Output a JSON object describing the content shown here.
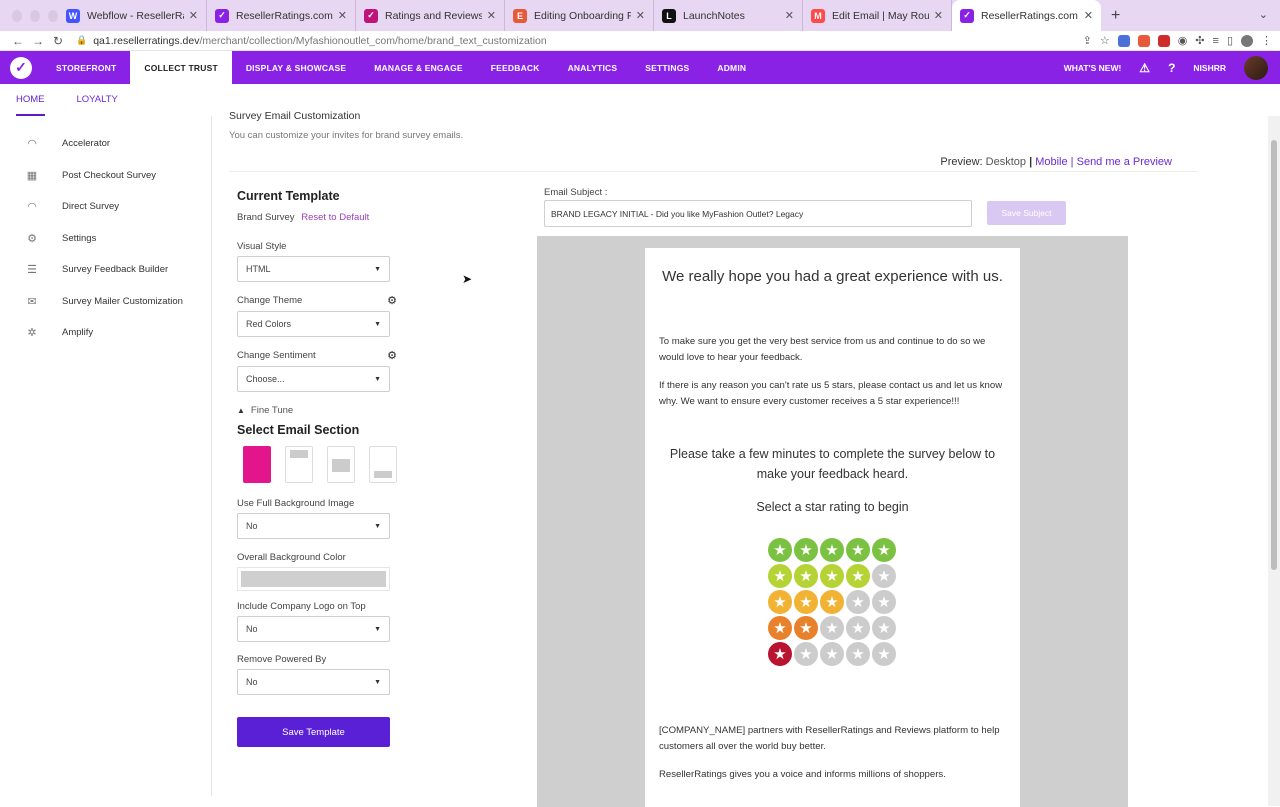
{
  "browser": {
    "tabs": [
      {
        "label": "Webflow - ResellerRatings Lea",
        "favicon": "W",
        "color": "#4353ff",
        "active": false
      },
      {
        "label": "ResellerRatings.com",
        "favicon": "✓",
        "color": "#8a22e6",
        "active": false
      },
      {
        "label": "Ratings and Reviews Learning",
        "favicon": "✓",
        "color": "#c0137a",
        "active": false
      },
      {
        "label": "Editing Onboarding Part II - Da",
        "favicon": "E",
        "color": "#e8593a",
        "active": false
      },
      {
        "label": "LaunchNotes",
        "favicon": "L",
        "color": "#111111",
        "active": false
      },
      {
        "label": "Edit Email | May RoundUp New",
        "favicon": "M",
        "color": "#ff4a4a",
        "active": false
      },
      {
        "label": "ResellerRatings.com",
        "favicon": "✓",
        "color": "#8a22e6",
        "active": true
      }
    ],
    "url_host": "qa1.resellerratings.dev",
    "url_path": "/merchant/collection/Myfashionoutlet_com/home/brand_text_customization"
  },
  "appnav": {
    "items": [
      "STOREFRONT",
      "COLLECT TRUST",
      "DISPLAY & SHOWCASE",
      "MANAGE & ENGAGE",
      "FEEDBACK",
      "ANALYTICS",
      "SETTINGS",
      "ADMIN"
    ],
    "active_index": 1,
    "whats_new": "WHAT'S NEW!",
    "user": "NISHRR"
  },
  "subnav": {
    "home": "HOME",
    "loyalty": "LOYALTY"
  },
  "sidebar": {
    "items": [
      {
        "label": "Accelerator",
        "icon": "gauge-icon"
      },
      {
        "label": "Post Checkout Survey",
        "icon": "calendar-icon"
      },
      {
        "label": "Direct Survey",
        "icon": "gauge-icon"
      },
      {
        "label": "Settings",
        "icon": "gear-icon"
      },
      {
        "label": "Survey Feedback Builder",
        "icon": "builder-icon"
      },
      {
        "label": "Survey Mailer Customization",
        "icon": "mailer-icon"
      },
      {
        "label": "Amplify",
        "icon": "network-icon"
      }
    ]
  },
  "main": {
    "section_title": "Survey Email Customization",
    "section_desc": "You can customize your invites for brand survey emails.",
    "preview_label": "Preview:",
    "preview_desktop": "Desktop",
    "preview_mobile": "Mobile",
    "preview_send": "Send me a Preview",
    "current_template": "Current Template",
    "template_name": "Brand Survey",
    "reset_default": "Reset to Default",
    "visual_style_label": "Visual Style",
    "visual_style_value": "HTML",
    "theme_label": "Change Theme",
    "theme_value": "Red Colors",
    "sentiment_label": "Change Sentiment",
    "sentiment_value": "Choose...",
    "fine_tune": "Fine Tune",
    "select_section": "Select Email Section",
    "full_bg_label": "Use Full Background Image",
    "full_bg_value": "No",
    "bg_color_label": "Overall Background Color",
    "bg_color": "#cfcfcf",
    "logo_label": "Include Company Logo on Top",
    "logo_value": "No",
    "powered_label": "Remove Powered By",
    "powered_value": "No",
    "save_template": "Save Template",
    "subject_label": "Email Subject :",
    "subject_value": "BRAND LEGACY INITIAL - Did you like MyFashion Outlet?  Legacy",
    "save_subject": "Save Subject"
  },
  "email_preview": {
    "heading": "We really hope you had a great experience with us.",
    "para1": "To make sure you get the very best service from us and continue to do so we would love to hear your feedback.",
    "para2": "If there is any reason you can't rate us 5 stars, please contact us and let us know why. We want to ensure every customer receives a 5 star experience!!!",
    "survey_prompt": "Please take a few minutes to complete the survey below to make your feedback heard.",
    "star_prompt": "Select a star rating to begin",
    "star_rows": [
      {
        "filled": 5,
        "color": "#7cc242"
      },
      {
        "filled": 4,
        "color": "#b5d334"
      },
      {
        "filled": 3,
        "color": "#f2b233"
      },
      {
        "filled": 2,
        "color": "#e8812b"
      },
      {
        "filled": 1,
        "color": "#b8142f"
      }
    ],
    "star_empty_color": "#cccccc",
    "partners": "[COMPANY_NAME] partners with ResellerRatings and Reviews platform to help customers all over the world buy better.",
    "voice": "ResellerRatings gives you a voice and informs millions of shoppers."
  }
}
